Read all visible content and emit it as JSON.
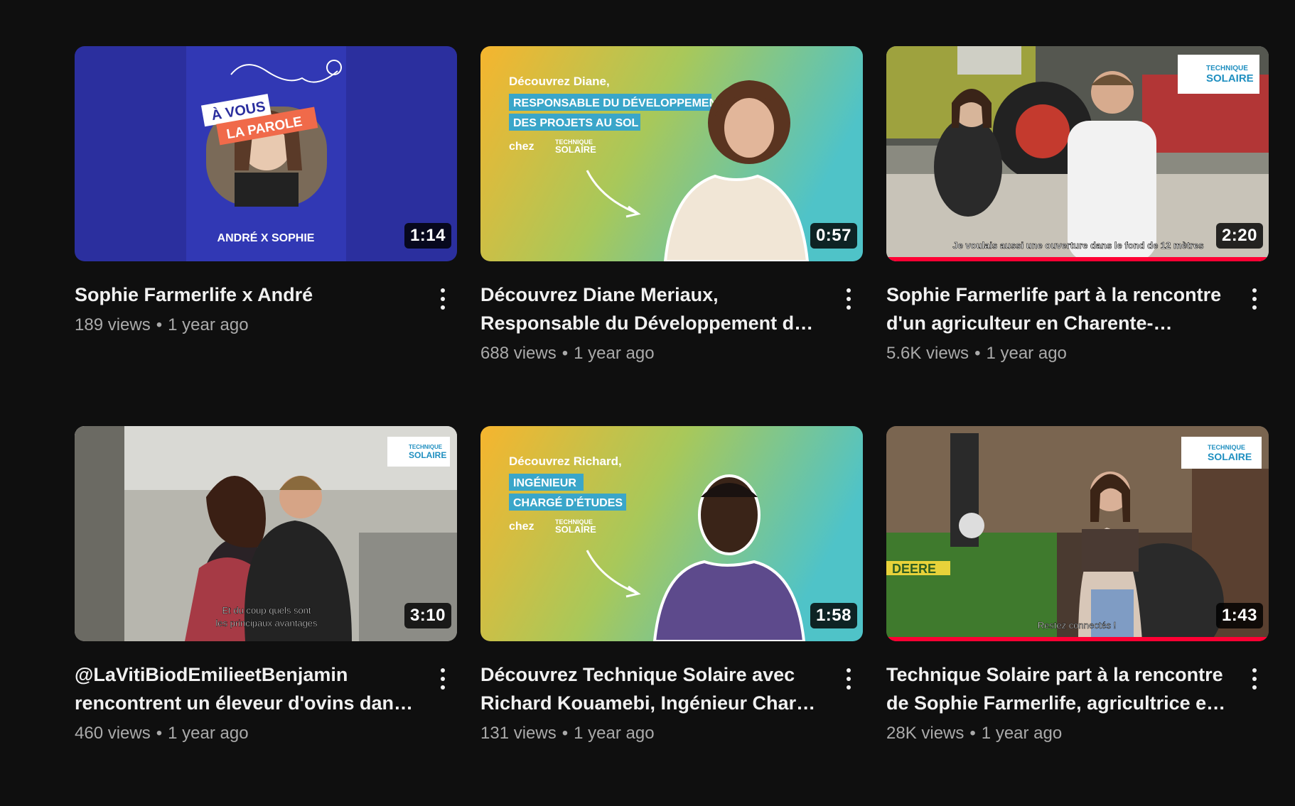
{
  "videos": [
    {
      "title": "Sophie Farmerlife x André",
      "views": "189 views",
      "age": "1 year ago",
      "duration": "1:14",
      "thumb_text": {
        "line1": "À VOUS",
        "line2": "LA PAROLE",
        "footer": "ANDRÉ X SOPHIE"
      },
      "watched": 0
    },
    {
      "title": "Découvrez Diane Meriaux, Responsable du Développement des Projets au Sol chez Technique Solaire",
      "views": "688 views",
      "age": "1 year ago",
      "duration": "0:57",
      "thumb_text": {
        "intro": "Découvrez Diane,",
        "role1": "RESPONSABLE DU DÉVELOPPEMENT",
        "role2": "DES PROJETS AU SOL",
        "chez": "chez",
        "brand1": "TECHNIQUE",
        "brand2": "SOLAIRE"
      },
      "watched": 0
    },
    {
      "title": "Sophie Farmerlife part à la rencontre d'un agriculteur en Charente-Maritime",
      "views": "5.6K views",
      "age": "1 year ago",
      "duration": "2:20",
      "thumb_text": {
        "subtitle": "Je voulais aussi une ouverture dans le fond de 12 mètres",
        "brand1": "TECHNIQUE",
        "brand2": "SOLAIRE"
      },
      "watched": 1.0
    },
    {
      "title": "@LaVitiBiodEmilieetBenjamin rencontrent un éleveur d'ovins dans les Deux-Sèvres",
      "views": "460 views",
      "age": "1 year ago",
      "duration": "3:10",
      "thumb_text": {
        "subtitle1": "Et du coup quels sont",
        "subtitle2": "les principaux avantages",
        "brand1": "TECHNIQUE",
        "brand2": "SOLAIRE"
      },
      "watched": 0
    },
    {
      "title": "Découvrez Technique Solaire avec Richard Kouamebi, Ingénieur Chargé d'Études",
      "views": "131 views",
      "age": "1 year ago",
      "duration": "1:58",
      "thumb_text": {
        "intro": "Découvrez Richard,",
        "role1": "INGÉNIEUR",
        "role2": "CHARGÉ D'ÉTUDES",
        "chez": "chez",
        "brand1": "TECHNIQUE",
        "brand2": "SOLAIRE"
      },
      "watched": 0
    },
    {
      "title": "Technique Solaire part à la rencontre de Sophie Farmerlife, agricultrice et influenceuse",
      "views": "28K views",
      "age": "1 year ago",
      "duration": "1:43",
      "thumb_text": {
        "subtitle": "Restez connectés !",
        "tractor": "DEERE",
        "brand1": "TECHNIQUE",
        "brand2": "SOLAIRE"
      },
      "watched": 1.0
    }
  ],
  "menu_icon": "more-vert-icon",
  "colors": {
    "progress": "#ff0033",
    "background": "#0f0f0f",
    "meta": "#aaaaaa"
  }
}
